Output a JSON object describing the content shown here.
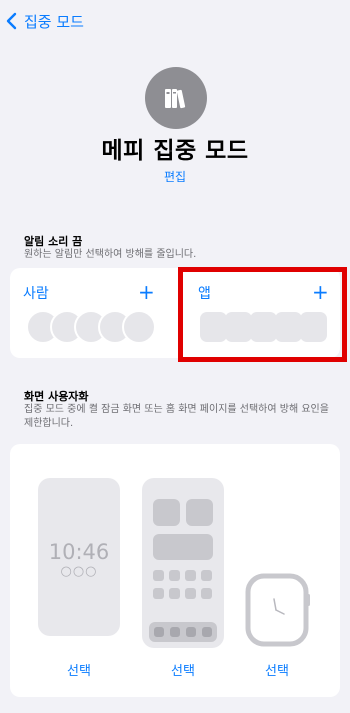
{
  "nav": {
    "back_label": "집중 모드"
  },
  "header": {
    "title": "메피 집중 모드",
    "edit_label": "편집"
  },
  "silence": {
    "title": "알림 소리 끔",
    "description": "원하는 알림만 선택하여 방해를 줄입니다.",
    "people_label": "사람",
    "apps_label": "앱",
    "add_symbol": "+"
  },
  "customize": {
    "title": "화면 사용자화",
    "description": "집중 모드 중에 켤 잠금 화면 또는 홈 화면 페이지를 선택하여 방해 요인을 제한합니다.",
    "lock_time": "10:46",
    "lock_dots": "○○○",
    "select_lock": "선택",
    "select_home": "선택",
    "select_watch": "선택"
  },
  "colors": {
    "accent": "#0a7cff",
    "highlight": "#e00000",
    "background": "#f2f2f7"
  },
  "icons": {
    "back": "chevron-left-icon",
    "focus": "books-icon",
    "add": "plus-icon"
  }
}
